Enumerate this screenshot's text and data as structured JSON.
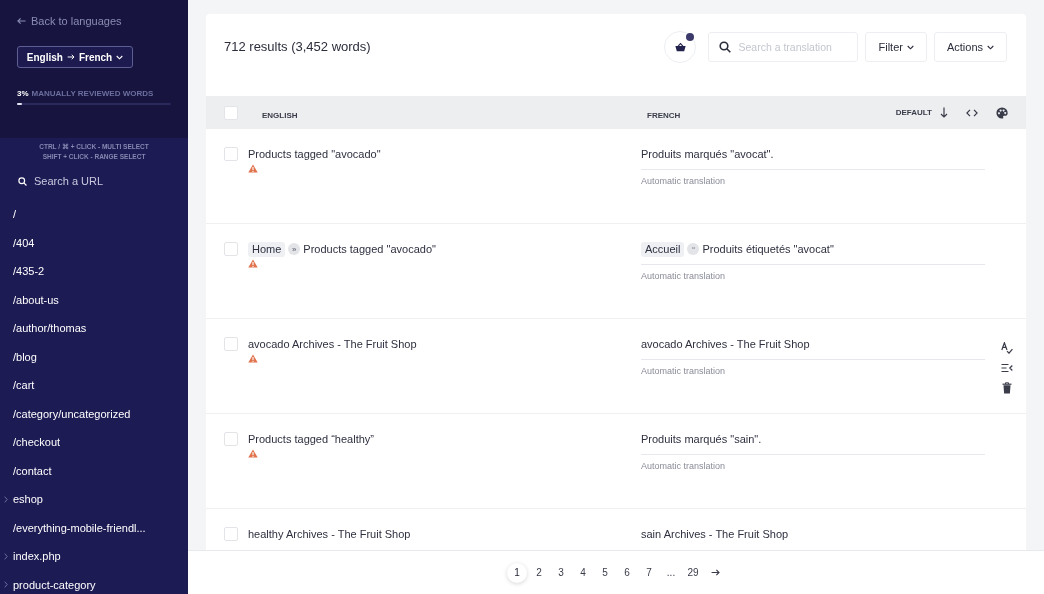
{
  "sidebar": {
    "back_link": "Back to languages",
    "language_pair": {
      "source": "English",
      "target": "French"
    },
    "review": {
      "percent": "3%",
      "label": "MANUALLY REVIEWED WORDS",
      "level": 0.03
    },
    "hints": [
      "CTRL / ⌘ + CLICK - MULTI SELECT",
      "SHIFT + CLICK - RANGE SELECT"
    ],
    "search": {
      "placeholder": "Search a URL"
    },
    "urls": [
      {
        "label": "/",
        "kind": "page"
      },
      {
        "label": "/404",
        "kind": "page"
      },
      {
        "label": "/435-2",
        "kind": "page"
      },
      {
        "label": "/about-us",
        "kind": "page"
      },
      {
        "label": "/author/thomas",
        "kind": "page"
      },
      {
        "label": "/blog",
        "kind": "page"
      },
      {
        "label": "/cart",
        "kind": "page"
      },
      {
        "label": "/category/uncategorized",
        "kind": "page"
      },
      {
        "label": "/checkout",
        "kind": "page"
      },
      {
        "label": "/contact",
        "kind": "page"
      },
      {
        "label": "eshop",
        "kind": "folder"
      },
      {
        "label": "/everything-mobile-friendl...",
        "kind": "page"
      },
      {
        "label": "index.php",
        "kind": "folder"
      },
      {
        "label": "product-category",
        "kind": "folder"
      }
    ]
  },
  "toolbar": {
    "results": "712 results (3,452 words)",
    "cart_badge": true,
    "search": {
      "placeholder": "Search a translation"
    },
    "buttons": [
      "Filter",
      "Actions"
    ]
  },
  "table": {
    "header_checked": false,
    "columns": [
      "ENGLISH",
      "FRENCH"
    ],
    "sort": "DEFAULT",
    "rows": [
      {
        "checked": false,
        "warning": true,
        "hovered": false,
        "source": [
          {
            "kind": "text",
            "text": "Products tagged \"avocado\""
          }
        ],
        "target": [
          {
            "kind": "text",
            "text": "Produits marqués \"avocat\"."
          }
        ],
        "status": "Automatic translation"
      },
      {
        "checked": false,
        "warning": true,
        "hovered": false,
        "source": [
          {
            "kind": "tag",
            "text": "Home"
          },
          {
            "kind": "separator",
            "text": "»"
          },
          {
            "kind": "text",
            "text": "Products tagged \"avocado\""
          }
        ],
        "target": [
          {
            "kind": "tag",
            "text": "Accueil"
          },
          {
            "kind": "separator",
            "text": "“"
          },
          {
            "kind": "text",
            "text": "Produits étiquetés \"avocat\""
          }
        ],
        "status": "Automatic translation"
      },
      {
        "checked": false,
        "warning": true,
        "hovered": true,
        "source": [
          {
            "kind": "text",
            "text": "avocado Archives - The Fruit Shop"
          }
        ],
        "target": [
          {
            "kind": "text",
            "text": "avocado Archives - The Fruit Shop"
          }
        ],
        "status": "Automatic translation"
      },
      {
        "checked": false,
        "warning": true,
        "hovered": false,
        "source": [
          {
            "kind": "text",
            "text": "Products tagged “healthy”"
          }
        ],
        "target": [
          {
            "kind": "text",
            "text": "Produits marqués \"sain\"."
          }
        ],
        "status": "Automatic translation"
      },
      {
        "checked": false,
        "warning": false,
        "hovered": false,
        "source": [
          {
            "kind": "text",
            "text": "healthy Archives - The Fruit Shop"
          }
        ],
        "target": [
          {
            "kind": "text",
            "text": "sain Archives - The Fruit Shop"
          }
        ]
      }
    ]
  },
  "pagination": {
    "pages": [
      {
        "label": "1",
        "selected": true
      },
      {
        "label": "2",
        "selected": false
      },
      {
        "label": "3",
        "selected": false
      },
      {
        "label": "4",
        "selected": false
      },
      {
        "label": "5",
        "selected": false
      },
      {
        "label": "6",
        "selected": false
      },
      {
        "label": "7",
        "selected": false
      }
    ],
    "ellipsis": "...",
    "last_page": {
      "label": "29",
      "selected": false
    }
  }
}
